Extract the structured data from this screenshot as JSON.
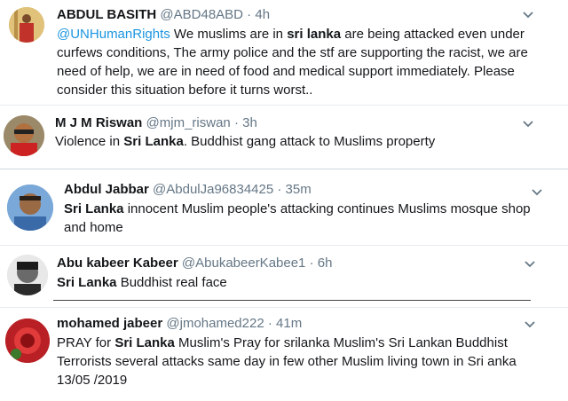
{
  "tweets": [
    {
      "name": "ABDUL BASITH",
      "handle": "@ABD48ABD",
      "time": "4h",
      "mention": "@UNHumanRights",
      "text1": " We muslims are in ",
      "bold1": "sri lanka",
      "text2": " are being attacked even under curfews conditions, The army police and the stf are supporting the racist, we are need of help, we are in need of food and medical support immediately. Please consider this situation before it turns worst.."
    },
    {
      "name": "M J M Riswan",
      "handle": "@mjm_riswan",
      "time": "3h",
      "text1": "Violence in ",
      "bold1": "Sri Lanka",
      "text2": ". Buddhist gang attack to Muslims property"
    },
    {
      "name": "Abdul Jabbar",
      "handle": "@AbdulJa96834425",
      "time": "35m",
      "bold1": "Sri Lanka",
      "text2": " innocent Muslim people's attacking continues Muslims mosque shop and home"
    },
    {
      "name": "Abu kabeer Kabeer",
      "handle": "@AbukabeerKabee1",
      "time": "6h",
      "bold1": "Sri Lanka",
      "text2": " Buddhist real face"
    },
    {
      "name": "mohamed jabeer",
      "handle": "@jmohamed222",
      "time": "41m",
      "text1": "PRAY for ",
      "bold1": "Sri Lanka",
      "text2": " Muslim's  Pray for srilanka Muslim's   Sri Lankan Buddhist Terrorists several attacks same day in few other Muslim living town in Sri anka 13/05 /2019"
    }
  ],
  "separator": " · ",
  "colors": {
    "name": "#14171a",
    "meta": "#657786",
    "link": "#1b95e0",
    "divider": "#e6ecf0"
  },
  "icons": {
    "caret": "chevron-down-icon"
  }
}
